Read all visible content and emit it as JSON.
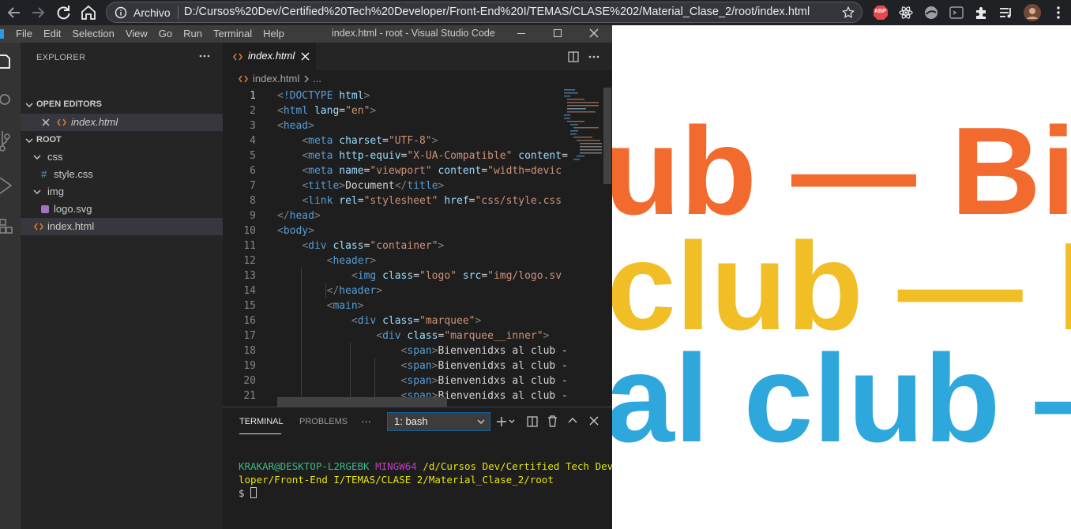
{
  "browser": {
    "omnibox_scheme": "Archivo",
    "omnibox_url": "D:/Cursos%20Dev/Certified%20Tech%20Developer/Front-End%20I/TEMAS/CLASE%202/Material_Clase_2/root/index.html",
    "extensions": [
      "abp-icon",
      "react-icon",
      "extension-icon",
      "extension-icon",
      "puzzle-icon",
      "media-icon",
      "avatar",
      "menu-icon"
    ],
    "abp_label": "ABP"
  },
  "vscode": {
    "menu": [
      "File",
      "Edit",
      "Selection",
      "View",
      "Go",
      "Run",
      "Terminal",
      "Help"
    ],
    "window_title": "index.html - root - Visual Studio Code",
    "sidebar": {
      "title": "EXPLORER",
      "open_editors_label": "OPEN EDITORS",
      "open_editor_file": "index.html",
      "root_label": "ROOT",
      "tree": [
        {
          "label": "css",
          "kind": "folder"
        },
        {
          "label": "style.css",
          "kind": "css"
        },
        {
          "label": "img",
          "kind": "folder"
        },
        {
          "label": "logo.svg",
          "kind": "svg"
        },
        {
          "label": "index.html",
          "kind": "html"
        }
      ]
    },
    "tab_label": "index.html",
    "breadcrumb": {
      "file": "index.html",
      "rest": "..."
    },
    "code_lines": [
      [
        [
          "br",
          "<"
        ],
        [
          "tg",
          "!DOCTYPE"
        ],
        [
          "tx",
          " "
        ],
        [
          "at",
          "html"
        ],
        [
          "br",
          ">"
        ]
      ],
      [
        [
          "br",
          "<"
        ],
        [
          "tg",
          "html"
        ],
        [
          "tx",
          " "
        ],
        [
          "at",
          "lang"
        ],
        [
          "tx",
          "="
        ],
        [
          "st",
          "\"en\""
        ],
        [
          "br",
          ">"
        ]
      ],
      [
        [
          "br",
          "<"
        ],
        [
          "tg",
          "head"
        ],
        [
          "br",
          ">"
        ]
      ],
      [
        [
          "tx",
          "    "
        ],
        [
          "br",
          "<"
        ],
        [
          "tg",
          "meta"
        ],
        [
          "tx",
          " "
        ],
        [
          "at",
          "charset"
        ],
        [
          "tx",
          "="
        ],
        [
          "st",
          "\"UTF-8\""
        ],
        [
          "br",
          ">"
        ]
      ],
      [
        [
          "tx",
          "    "
        ],
        [
          "br",
          "<"
        ],
        [
          "tg",
          "meta"
        ],
        [
          "tx",
          " "
        ],
        [
          "at",
          "http-equiv"
        ],
        [
          "tx",
          "="
        ],
        [
          "st",
          "\"X-UA-Compatible\""
        ],
        [
          "tx",
          " "
        ],
        [
          "at",
          "content"
        ],
        [
          "tx",
          "="
        ]
      ],
      [
        [
          "tx",
          "    "
        ],
        [
          "br",
          "<"
        ],
        [
          "tg",
          "meta"
        ],
        [
          "tx",
          " "
        ],
        [
          "at",
          "name"
        ],
        [
          "tx",
          "="
        ],
        [
          "st",
          "\"viewport\""
        ],
        [
          "tx",
          " "
        ],
        [
          "at",
          "content"
        ],
        [
          "tx",
          "="
        ],
        [
          "st",
          "\"width=devic"
        ]
      ],
      [
        [
          "tx",
          "    "
        ],
        [
          "br",
          "<"
        ],
        [
          "tg",
          "title"
        ],
        [
          "br",
          ">"
        ],
        [
          "tx",
          "Document"
        ],
        [
          "br",
          "</"
        ],
        [
          "tg",
          "title"
        ],
        [
          "br",
          ">"
        ]
      ],
      [
        [
          "tx",
          "    "
        ],
        [
          "br",
          "<"
        ],
        [
          "tg",
          "link"
        ],
        [
          "tx",
          " "
        ],
        [
          "at",
          "rel"
        ],
        [
          "tx",
          "="
        ],
        [
          "st",
          "\"stylesheet\""
        ],
        [
          "tx",
          " "
        ],
        [
          "at",
          "href"
        ],
        [
          "tx",
          "="
        ],
        [
          "st",
          "\"css/style.css"
        ]
      ],
      [
        [
          "br",
          "</"
        ],
        [
          "tg",
          "head"
        ],
        [
          "br",
          ">"
        ]
      ],
      [
        [
          "br",
          "<"
        ],
        [
          "tg",
          "body"
        ],
        [
          "br",
          ">"
        ]
      ],
      [
        [
          "tx",
          "    "
        ],
        [
          "br",
          "<"
        ],
        [
          "tg",
          "div"
        ],
        [
          "tx",
          " "
        ],
        [
          "at",
          "class"
        ],
        [
          "tx",
          "="
        ],
        [
          "st",
          "\"container\""
        ],
        [
          "br",
          ">"
        ]
      ],
      [
        [
          "tx",
          "        "
        ],
        [
          "br",
          "<"
        ],
        [
          "tg",
          "header"
        ],
        [
          "br",
          ">"
        ]
      ],
      [
        [
          "tx",
          "            "
        ],
        [
          "br",
          "<"
        ],
        [
          "tg",
          "img"
        ],
        [
          "tx",
          " "
        ],
        [
          "at",
          "class"
        ],
        [
          "tx",
          "="
        ],
        [
          "st",
          "\"logo\""
        ],
        [
          "tx",
          " "
        ],
        [
          "at",
          "src"
        ],
        [
          "tx",
          "="
        ],
        [
          "st",
          "\"img/logo.sv"
        ]
      ],
      [
        [
          "tx",
          "        "
        ],
        [
          "br",
          "</"
        ],
        [
          "tg",
          "header"
        ],
        [
          "br",
          ">"
        ]
      ],
      [
        [
          "tx",
          "        "
        ],
        [
          "br",
          "<"
        ],
        [
          "tg",
          "main"
        ],
        [
          "br",
          ">"
        ]
      ],
      [
        [
          "tx",
          "            "
        ],
        [
          "br",
          "<"
        ],
        [
          "tg",
          "div"
        ],
        [
          "tx",
          " "
        ],
        [
          "at",
          "class"
        ],
        [
          "tx",
          "="
        ],
        [
          "st",
          "\"marquee\""
        ],
        [
          "br",
          ">"
        ]
      ],
      [
        [
          "tx",
          "                "
        ],
        [
          "br",
          "<"
        ],
        [
          "tg",
          "div"
        ],
        [
          "tx",
          " "
        ],
        [
          "at",
          "class"
        ],
        [
          "tx",
          "="
        ],
        [
          "st",
          "\"marquee__inner\""
        ],
        [
          "br",
          ">"
        ]
      ],
      [
        [
          "tx",
          "                    "
        ],
        [
          "br",
          "<"
        ],
        [
          "tg",
          "span"
        ],
        [
          "br",
          ">"
        ],
        [
          "tx",
          "Bienvenidxs al club -"
        ]
      ],
      [
        [
          "tx",
          "                    "
        ],
        [
          "br",
          "<"
        ],
        [
          "tg",
          "span"
        ],
        [
          "br",
          ">"
        ],
        [
          "tx",
          "Bienvenidxs al club -"
        ]
      ],
      [
        [
          "tx",
          "                    "
        ],
        [
          "br",
          "<"
        ],
        [
          "tg",
          "span"
        ],
        [
          "br",
          ">"
        ],
        [
          "tx",
          "Bienvenidxs al club -"
        ]
      ],
      [
        [
          "tx",
          "                    "
        ],
        [
          "br",
          "<"
        ],
        [
          "tg",
          "span"
        ],
        [
          "br",
          ">"
        ],
        [
          "tx",
          "Bienvenidxs al club -"
        ]
      ]
    ],
    "panel": {
      "tabs": [
        "TERMINAL",
        "PROBLEMS"
      ],
      "more": "···",
      "terminal_select": "1: bash",
      "prompt_user": "KRAKAR@DESKTOP-L2RGEBK",
      "prompt_env": "MINGW64",
      "prompt_path_1": "/d/Cursos Dev/Certified Tech Deve",
      "prompt_path_2": "loper/Front-End I/TEMAS/CLASE 2/Material_Clase_2/root",
      "prompt_symbol": "$"
    }
  },
  "webpage": {
    "marquee_lines": [
      {
        "text": "ub — Bie",
        "color": "#f26a2e"
      },
      {
        "text": "club — B",
        "color": "#f1be25"
      },
      {
        "text": "al club —",
        "color": "#2ea8dc"
      }
    ]
  },
  "colors": {
    "vscode_bg": "#1e1e1e",
    "accent": "#0e639c",
    "orange": "#f26a2e",
    "yellow": "#f1be25",
    "blue": "#2ea8dc"
  }
}
